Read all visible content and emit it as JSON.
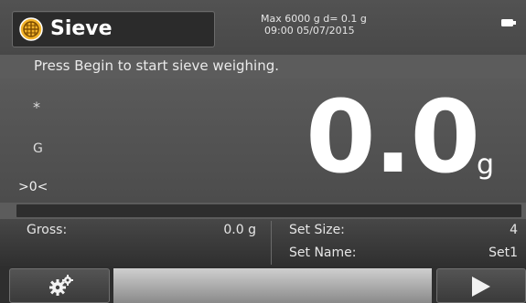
{
  "header": {
    "app_title": "Sieve",
    "max_capacity": "Max 6000 g  d= 0.1 g",
    "datetime": "09:00   05/07/2015",
    "app_icon": "sieve-globe-icon",
    "battery_icon": "battery-icon"
  },
  "instruction": "Press Begin to start sieve weighing.",
  "indicators": {
    "stability": "*",
    "gross_net": "G",
    "zero": ">0<"
  },
  "display": {
    "weight": "0.0",
    "unit": "g"
  },
  "info": {
    "gross_label": "Gross:",
    "gross_value": "0.0 g",
    "set_size_label": "Set Size:",
    "set_size_value": "4",
    "set_name_label": "Set Name:",
    "set_name_value": "Set1"
  },
  "toolbar": {
    "settings_icon": "gear-icon",
    "begin_icon": "play-icon"
  },
  "colors": {
    "background": "#5c5c5c",
    "header_chip": "#2b2b2b",
    "text": "#ffffff",
    "icon_accent": "#e8a21a"
  }
}
